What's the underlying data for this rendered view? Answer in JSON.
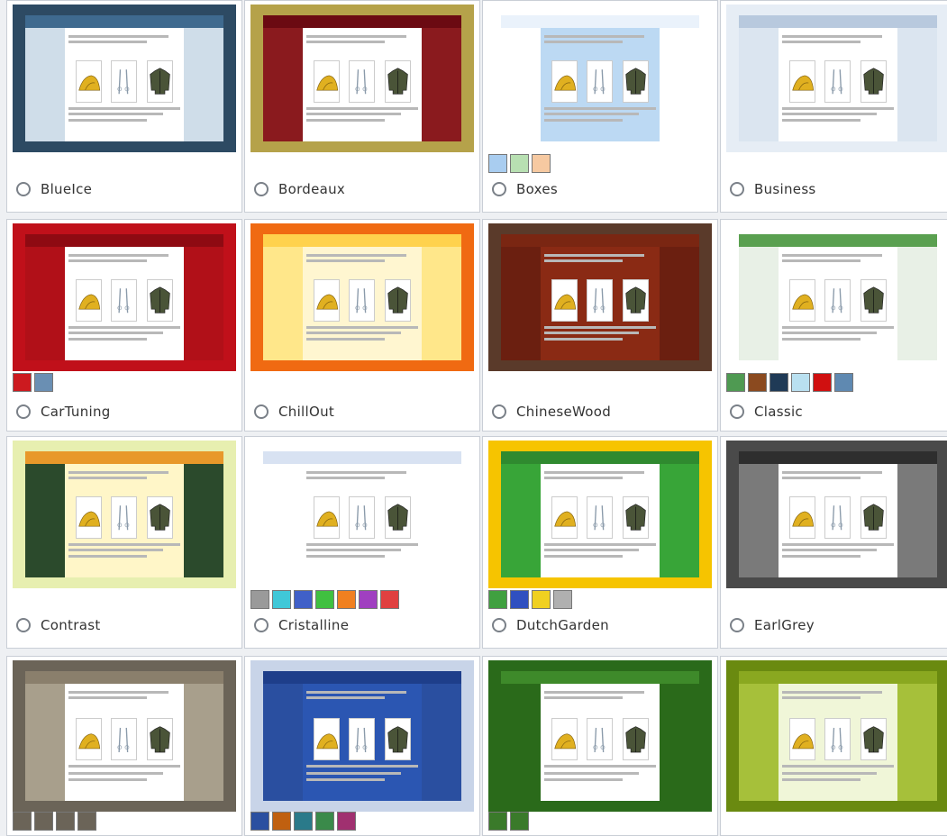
{
  "themes": [
    {
      "name": "BlueIce",
      "colors": {
        "frame": "#2d4a63",
        "bar": "#3f6a8f",
        "side": "#cfdde9",
        "content": "#ffffff"
      },
      "swatches": []
    },
    {
      "name": "Bordeaux",
      "colors": {
        "frame": "#b5a24a",
        "bar": "#6b0a12",
        "side": "#8a1a1e",
        "content": "#ffffff"
      },
      "swatches": []
    },
    {
      "name": "Boxes",
      "colors": {
        "frame": "#ffffff",
        "bar": "#eaf2fb",
        "side": "#ffffff",
        "content": "#bcd9f3"
      },
      "swatches": [
        "#a9cdf0",
        "#b8e0b2",
        "#f6c9a1"
      ]
    },
    {
      "name": "Business",
      "colors": {
        "frame": "#e6edf5",
        "bar": "#b8c9de",
        "side": "#dbe5f0",
        "content": "#ffffff"
      },
      "swatches": []
    },
    {
      "name": "CarTuning",
      "colors": {
        "frame": "#c0101a",
        "bar": "#8e0a12",
        "side": "#b11018",
        "content": "#ffffff"
      },
      "swatches": [
        "#cc1a1f",
        "#6a8fb3"
      ]
    },
    {
      "name": "ChillOut",
      "colors": {
        "frame": "#f06a12",
        "bar": "#ffd24d",
        "side": "#ffe78a",
        "content": "#fff6d0"
      },
      "swatches": []
    },
    {
      "name": "ChineseWood",
      "colors": {
        "frame": "#5a3a2a",
        "bar": "#7a2612",
        "side": "#6b1f10",
        "content": "#8a2a14"
      },
      "swatches": []
    },
    {
      "name": "Classic",
      "colors": {
        "frame": "#ffffff",
        "bar": "#5aa050",
        "side": "#e8f0e6",
        "content": "#ffffff"
      },
      "swatches": [
        "#4f9a52",
        "#8b4a1f",
        "#1f3a56",
        "#b9e0f0",
        "#d01010",
        "#5f89b1"
      ]
    },
    {
      "name": "Contrast",
      "colors": {
        "frame": "#e7efb0",
        "bar": "#e8982a",
        "side": "#2b4a2c",
        "content": "#fff6c8"
      },
      "swatches": []
    },
    {
      "name": "Cristalline",
      "colors": {
        "frame": "#ffffff",
        "bar": "#d8e2f2",
        "side": "#ffffff",
        "content": "#ffffff"
      },
      "swatches": [
        "#9a9a9a",
        "#40c8d8",
        "#4060c8",
        "#40c040",
        "#f08020",
        "#a040c0",
        "#e04040"
      ]
    },
    {
      "name": "DutchGarden",
      "colors": {
        "frame": "#f6c400",
        "bar": "#2f8a2f",
        "side": "#38a538",
        "content": "#ffffff"
      },
      "swatches": [
        "#40a040",
        "#3050c0",
        "#f0d020",
        "#b0b0b0"
      ]
    },
    {
      "name": "EarlGrey",
      "colors": {
        "frame": "#4a4a4a",
        "bar": "#2e2e2e",
        "side": "#7a7a7a",
        "content": "#ffffff"
      },
      "swatches": []
    },
    {
      "name": "",
      "colors": {
        "frame": "#6b6458",
        "bar": "#8a7f6c",
        "side": "#a89f8c",
        "content": "#ffffff"
      },
      "swatches": [
        "#6b6458",
        "#6b6458",
        "#6b6458",
        "#6b6458"
      ]
    },
    {
      "name": "",
      "colors": {
        "frame": "#c8d4e8",
        "bar": "#1e3e8a",
        "side": "#2a4fa0",
        "content": "#2b56b2"
      },
      "swatches": [
        "#2a4fa0",
        "#c06010",
        "#2a7a8a",
        "#3a8a4a",
        "#a03070"
      ]
    },
    {
      "name": "",
      "colors": {
        "frame": "#2a6a1a",
        "bar": "#3e8a2a",
        "side": "#2a6a1a",
        "content": "#ffffff"
      },
      "swatches": [
        "#3a7a2a",
        "#3a7a2a"
      ]
    },
    {
      "name": "",
      "colors": {
        "frame": "#6a8a10",
        "bar": "#8aa820",
        "side": "#a6c03a",
        "content": "#f0f6d8"
      },
      "swatches": []
    }
  ]
}
